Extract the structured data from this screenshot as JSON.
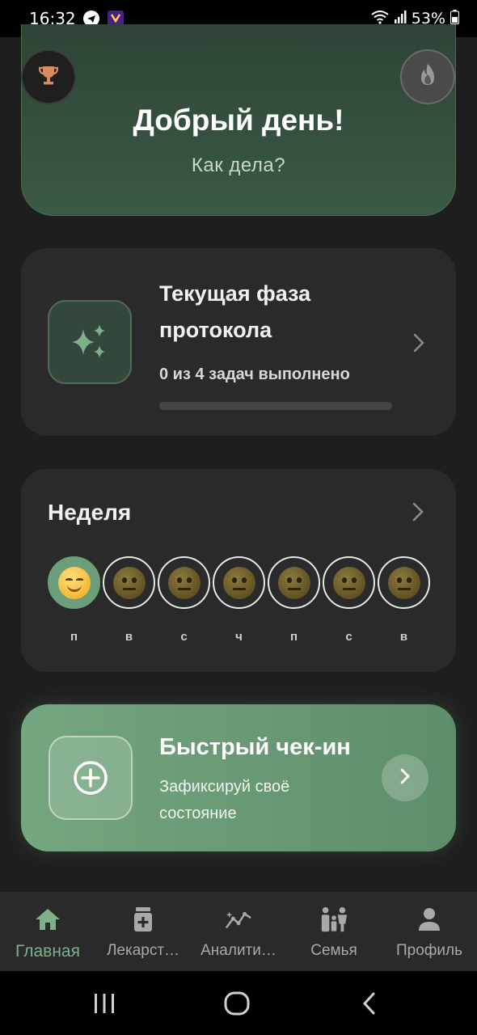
{
  "status_bar": {
    "time": "16:32",
    "battery": "53%",
    "icons": [
      "telegram-icon",
      "app-icon",
      "wifi-icon",
      "signal-icon",
      "battery-icon"
    ]
  },
  "header": {
    "title": "Добрый день!",
    "subtitle": "Как дела?",
    "left_icon": "trophy-icon",
    "right_icon": "fire-icon"
  },
  "phase_card": {
    "title": "Текущая фаза протокола",
    "tasks_status": "0 из 4 задач выполнено",
    "progress": 0,
    "icon": "sparkles-icon"
  },
  "week": {
    "title": "Неделя",
    "days": [
      {
        "label": "п",
        "mood": "happy",
        "active": true
      },
      {
        "label": "в",
        "mood": "neutral",
        "active": false
      },
      {
        "label": "с",
        "mood": "neutral",
        "active": false
      },
      {
        "label": "ч",
        "mood": "neutral",
        "active": false
      },
      {
        "label": "п",
        "mood": "neutral",
        "active": false
      },
      {
        "label": "с",
        "mood": "neutral",
        "active": false
      },
      {
        "label": "в",
        "mood": "neutral",
        "active": false
      }
    ]
  },
  "checkin": {
    "title": "Быстрый чек-ин",
    "subtitle": "Зафиксируй своё состояние",
    "icon": "plus-circle-icon"
  },
  "bottom_nav": {
    "items": [
      {
        "label": "Главная",
        "icon": "home-icon",
        "active": true
      },
      {
        "label": "Лекарст…",
        "icon": "medicine-icon",
        "active": false
      },
      {
        "label": "Аналити…",
        "icon": "analytics-icon",
        "active": false
      },
      {
        "label": "Семья",
        "icon": "family-icon",
        "active": false
      },
      {
        "label": "Профиль",
        "icon": "profile-icon",
        "active": false
      }
    ]
  },
  "colors": {
    "accent": "#7fb08c",
    "background": "#1e1e1e",
    "card": "#2a2a2a"
  }
}
